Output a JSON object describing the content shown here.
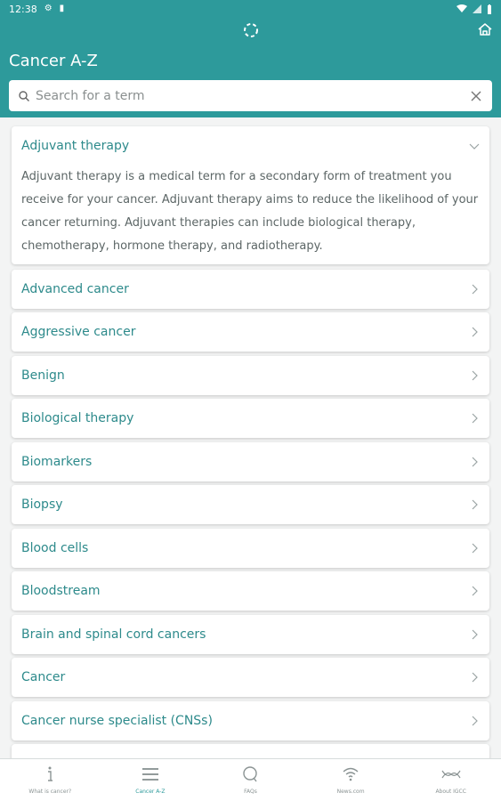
{
  "status_bar": {
    "time": "12:38"
  },
  "header": {
    "title": "Cancer A-Z"
  },
  "search": {
    "placeholder": "Search for a term"
  },
  "terms": [
    {
      "label": "Adjuvant therapy",
      "expanded": true,
      "description": "Adjuvant therapy is a medical term for a secondary form of treatment you receive for your cancer. Adjuvant therapy aims to reduce the likelihood of your cancer returning. Adjuvant therapies can include biological therapy, chemotherapy, hormone therapy, and radiotherapy."
    },
    {
      "label": "Advanced cancer"
    },
    {
      "label": "Aggressive cancer"
    },
    {
      "label": "Benign"
    },
    {
      "label": "Biological therapy"
    },
    {
      "label": "Biomarkers"
    },
    {
      "label": "Biopsy"
    },
    {
      "label": "Blood cells"
    },
    {
      "label": "Bloodstream"
    },
    {
      "label": "Brain and spinal cord cancers"
    },
    {
      "label": "Cancer"
    },
    {
      "label": "Cancer nurse specialist (CNSs)"
    }
  ],
  "bottom_nav": [
    {
      "label": "What is cancer?",
      "icon": "info-icon"
    },
    {
      "label": "Cancer A-Z",
      "icon": "list-icon",
      "active": true
    },
    {
      "label": "FAQs",
      "icon": "chat-bubble-icon"
    },
    {
      "label": "News.com",
      "icon": "wifi-icon"
    },
    {
      "label": "About IGCC",
      "icon": "dna-icon"
    }
  ],
  "colors": {
    "primary": "#2d9a9b",
    "label_teal": "#2d8a8b",
    "background": "#f3f4f4"
  }
}
